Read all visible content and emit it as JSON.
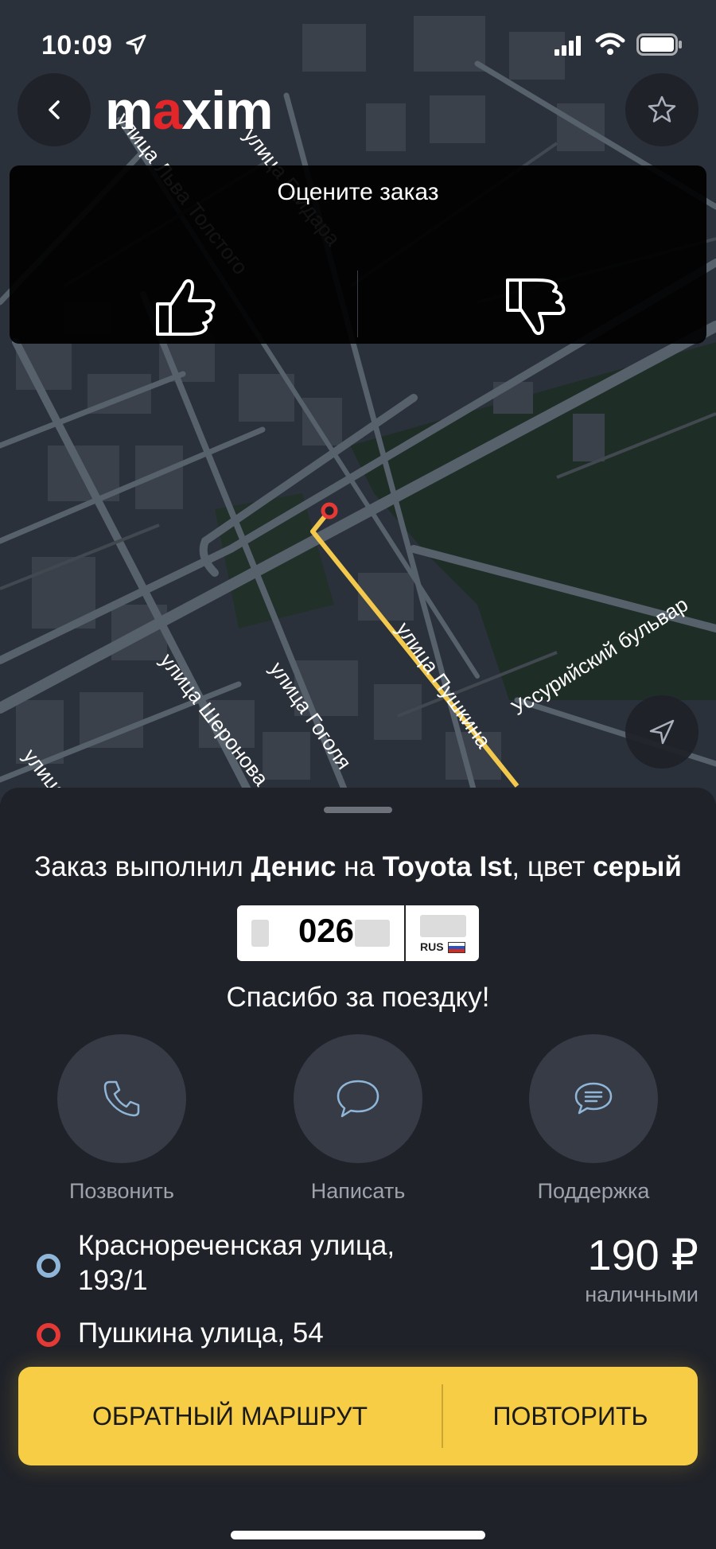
{
  "status_bar": {
    "time": "10:09"
  },
  "header": {
    "logo_text_1": "m",
    "logo_text_2": "a",
    "logo_text_3": "xim"
  },
  "rating": {
    "title": "Оцените заказ"
  },
  "map": {
    "streets": [
      "улица Льва Толстого",
      "улица Гайдара",
      "улица Пушкина",
      "Уссурийский бульвар",
      "улица Гоголя",
      "улица Шеронова",
      "улица"
    ]
  },
  "order": {
    "prefix": "Заказ выполнил ",
    "driver": "Денис",
    "mid": " на ",
    "car": "Toyota Ist",
    "color_prefix": ", цвет ",
    "color": "серый",
    "plate_number": "026",
    "plate_region": "RUS",
    "thanks": "Спасибо за поездку!"
  },
  "actions": {
    "call": "Позвонить",
    "write": "Написать",
    "support": "Поддержка"
  },
  "route": {
    "from": "Краснореченская улица, 193/1",
    "to": "Пушкина улица, 54"
  },
  "payment": {
    "price": "190 ₽",
    "method": "наличными"
  },
  "buttons": {
    "return_route": "ОБРАТНЫЙ МАРШРУТ",
    "repeat": "ПОВТОРИТЬ"
  },
  "colors": {
    "accent": "#f6cd45",
    "route": "#f2c94c",
    "from_dot": "#8fb6d8",
    "to_dot": "#e53935",
    "logo_accent": "#e3262a"
  }
}
